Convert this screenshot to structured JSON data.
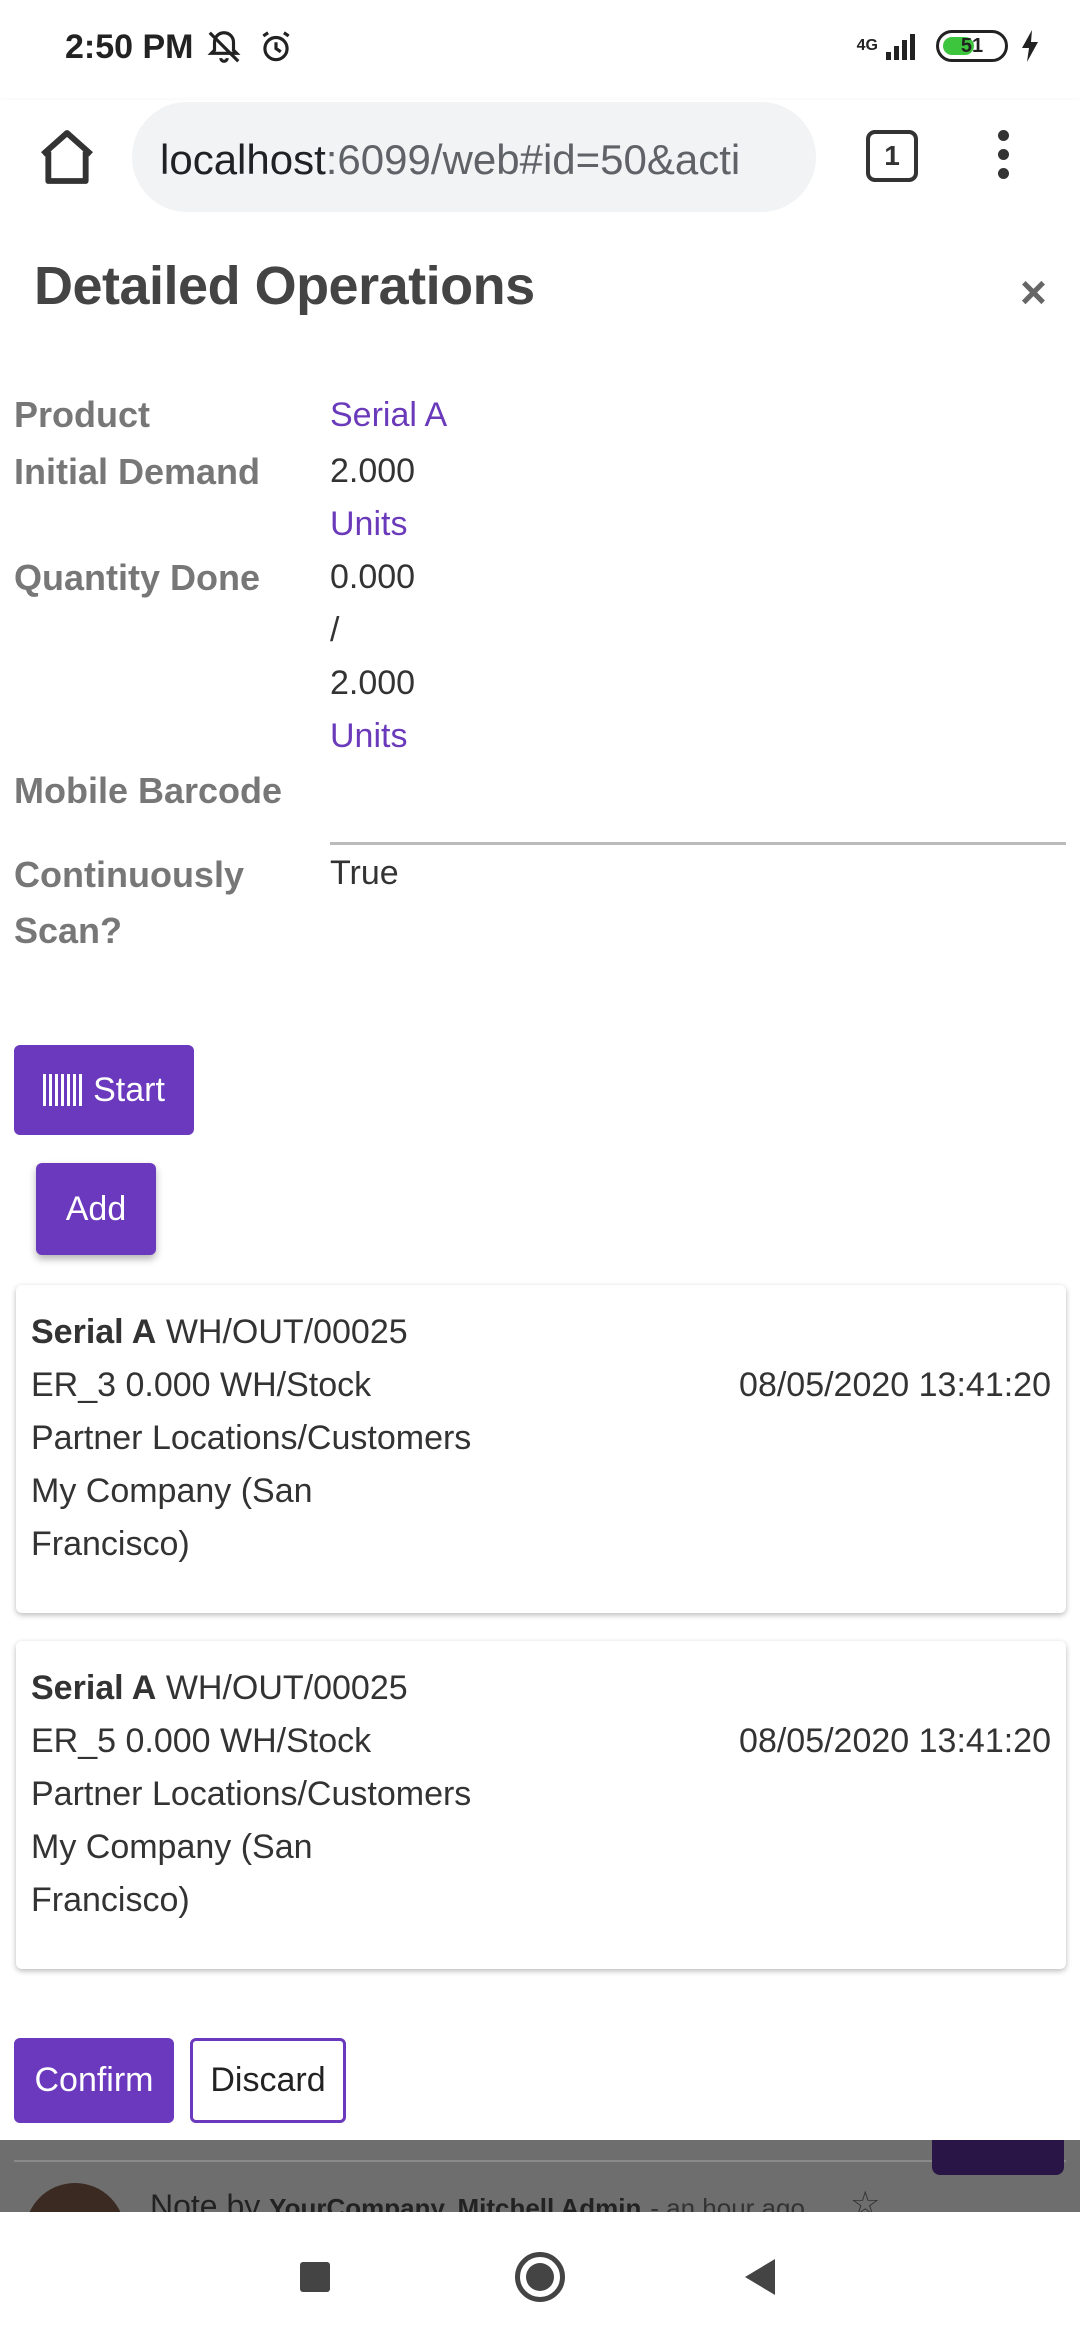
{
  "status_bar": {
    "time": "2:50 PM",
    "network": "4G",
    "battery_percent": "51",
    "battery_level": 0.51
  },
  "browser": {
    "url_host": "localhost",
    "url_rest": ":6099/web#id=50&acti",
    "tab_count": "1"
  },
  "dialog": {
    "title": "Detailed Operations",
    "close_label": "×",
    "fields": {
      "product_label": "Product",
      "product_value": "Serial A",
      "initial_demand_label": "Initial Demand",
      "initial_demand_value": "2.000",
      "initial_demand_uom": "Units",
      "quantity_done_label": "Quantity Done",
      "quantity_done_value": "0.000",
      "quantity_done_sep": "/",
      "quantity_done_total": "2.000",
      "quantity_done_uom": "Units",
      "mobile_barcode_label": "Mobile Barcode",
      "continuously_scan_label_1": "Continuously",
      "continuously_scan_label_2": "Scan?",
      "continuously_scan_value": "True"
    },
    "start_label": "Start",
    "add_label": "Add",
    "move_lines": [
      {
        "product": "Serial A",
        "reference": "WH/OUT/00025",
        "lot_qty_location": "ER_3 0.000 WH/Stock",
        "date": "08/05/2020 13:41:20",
        "dest_location": "Partner Locations/Customers",
        "company_1": "My Company (San",
        "company_2": "Francisco)"
      },
      {
        "product": "Serial A",
        "reference": "WH/OUT/00025",
        "lot_qty_location": "ER_5 0.000 WH/Stock",
        "date": "08/05/2020 13:41:20",
        "dest_location": "Partner Locations/Customers",
        "company_1": "My Company (San",
        "company_2": "Francisco)"
      }
    ],
    "confirm_label": "Confirm",
    "discard_label": "Discard"
  },
  "background": {
    "note_prefix": "Note by",
    "note_author": "YourCompany, Mitchell Admin",
    "note_time": "- an hour ago"
  },
  "colors": {
    "primary": "#6b39bd",
    "link": "#6a3aba",
    "battery": "#3ec53e"
  }
}
